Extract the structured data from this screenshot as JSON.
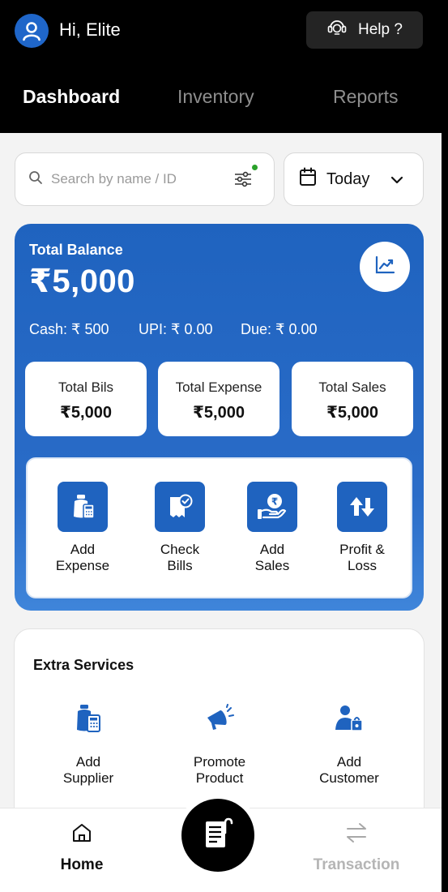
{
  "header": {
    "greeting": "Hi, Elite",
    "avatar_icon": "user-avatar-icon",
    "help_label": "Help ?",
    "help_icon": "support-headset-icon"
  },
  "tabs": [
    {
      "label": "Dashboard",
      "active": true
    },
    {
      "label": "Inventory",
      "active": false
    },
    {
      "label": "Reports",
      "active": false
    }
  ],
  "search": {
    "placeholder": "Search by name / ID",
    "filter_icon": "filter-sliders-icon",
    "filter_active_color": "#2aa12a"
  },
  "date_filter": {
    "value": "Today",
    "icon": "calendar-icon"
  },
  "balance": {
    "label": "Total Balance",
    "amount": "₹5,000",
    "cash": "Cash: ₹ 500",
    "upi": "UPI: ₹ 0.00",
    "due": "Due: ₹ 0.00",
    "accent": "#1f63bf",
    "stats": [
      {
        "label": "Total Bils",
        "value": "₹5,000"
      },
      {
        "label": "Total Expense",
        "value": "₹5,000"
      },
      {
        "label": "Total Sales",
        "value": "₹5,000"
      }
    ],
    "actions": [
      {
        "label": "Add\nExpense",
        "icon": "expense-wallet-icon"
      },
      {
        "label": "Check\nBills",
        "icon": "bill-check-icon"
      },
      {
        "label": "Add\nSales",
        "icon": "rupee-hand-icon"
      },
      {
        "label": "Profit &\nLoss",
        "icon": "up-down-arrows-icon"
      }
    ]
  },
  "extra_services": {
    "title": "Extra Services",
    "items": [
      {
        "label": "Add\nSupplier",
        "icon": "supplier-icon"
      },
      {
        "label": "Promote\nProduct",
        "icon": "megaphone-icon"
      },
      {
        "label": "Add\nCustomer",
        "icon": "customer-icon"
      }
    ]
  },
  "bottom_nav": {
    "home": "Home",
    "transaction": "Transaction",
    "center_icon": "billing-document-icon"
  }
}
